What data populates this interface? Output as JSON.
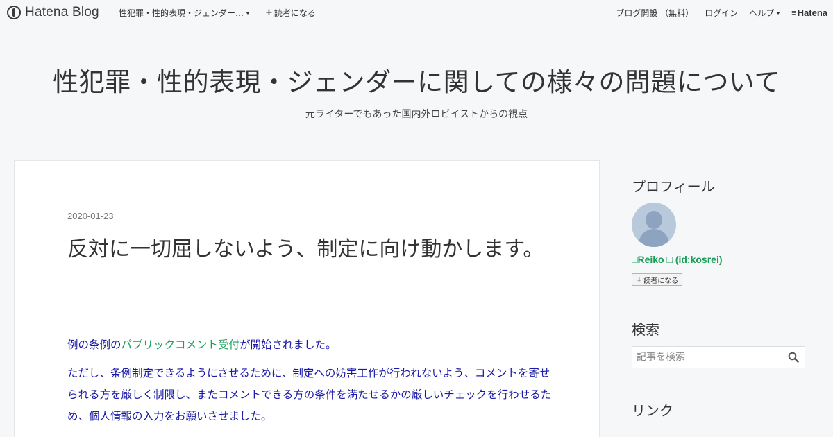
{
  "header": {
    "logo_text": "Hatena Blog",
    "blog_menu_label": "性犯罪・性的表現・ジェンダー…",
    "subscribe_label": "読者になる",
    "open_blog_label": "ブログ開設 （無料）",
    "login_label": "ログイン",
    "help_label": "ヘルプ",
    "hatena_label": "Hatena"
  },
  "blog": {
    "title": "性犯罪・性的表現・ジェンダーに関しての様々の問題について",
    "description": "元ライターでもあった国内外ロビイストからの視点"
  },
  "entry": {
    "date": "2020-01-23",
    "title": "反対に一切屈しないよう、制定に向け動かします。",
    "p1_before": "例の条例の",
    "p1_link": "パブリックコメント受付",
    "p1_after": "が開始されました。",
    "p2": "ただし、条例制定できるようにさせるために、制定への妨害工作が行われないよう、コメントを寄せられる方を厳しく制限し、またコメントできる方の条件を満たせるかの厳しいチェックを行わせるため、個人情報の入力をお願いさせました。"
  },
  "sidebar": {
    "profile_heading": "プロフィール",
    "profile_name": "□Reiko □ (id:kosrei)",
    "reader_button": "読者になる",
    "search_heading": "検索",
    "search_placeholder": "記事を検索",
    "links_heading": "リンク"
  },
  "colors": {
    "accent_green": "#1a9e5a",
    "body_text_blue": "#1a1aa6",
    "avatar_bg": "#b9c9dc"
  }
}
